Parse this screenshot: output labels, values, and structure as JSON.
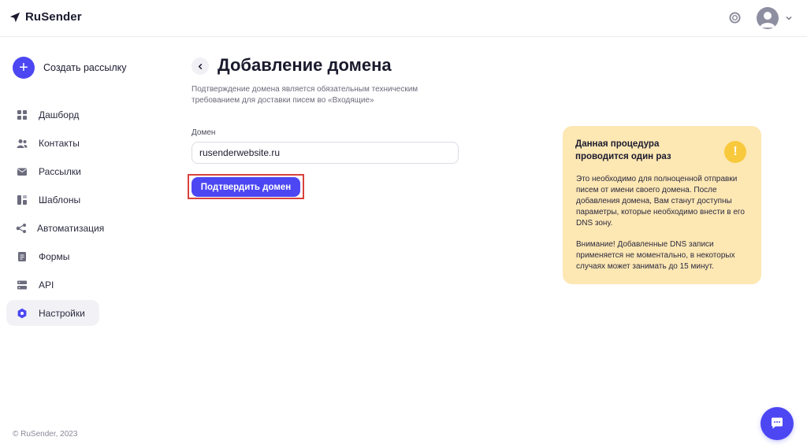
{
  "app": {
    "name": "RuSender"
  },
  "colors": {
    "accent": "#4c47f2",
    "info_bg": "#fde7b3",
    "warning": "#f8c93c",
    "highlight": "#d9413c"
  },
  "header": {
    "help_icon": "lifebuoy-icon",
    "avatar_icon": "user-avatar-icon",
    "menu_icon": "chevron-down-icon"
  },
  "sidebar": {
    "create_label": "Создать рассылку",
    "items": [
      {
        "label": "Дашборд",
        "icon": "dashboard-icon",
        "active": false
      },
      {
        "label": "Контакты",
        "icon": "contacts-icon",
        "active": false
      },
      {
        "label": "Рассылки",
        "icon": "mailings-icon",
        "active": false
      },
      {
        "label": "Шаблоны",
        "icon": "templates-icon",
        "active": false
      },
      {
        "label": "Автоматизация",
        "icon": "automation-icon",
        "active": false
      },
      {
        "label": "Формы",
        "icon": "forms-icon",
        "active": false
      },
      {
        "label": "API",
        "icon": "api-icon",
        "active": false
      },
      {
        "label": "Настройки",
        "icon": "settings-icon",
        "active": true
      }
    ],
    "footer": "© RuSender, 2023"
  },
  "main": {
    "title": "Добавление домена",
    "subtitle": "Подтверждение домена является обязательным техническим требованием для доставки писем во «Входящие»",
    "domain_label": "Домен",
    "domain_value": "rusenderwebsite.ru",
    "confirm_label": "Подтвердить домен"
  },
  "info": {
    "title": "Данная процедура проводится один раз",
    "text1": "Это необходимо для полноценной отправки писем от имени своего домена. После добавления домена, Вам станут доступны параметры, которые необходимо внести в его DNS зону.",
    "text2": "Внимание! Добавленные DNS записи применяется не моментально, в некоторых случаях может занимать до 15 минут.",
    "icon_glyph": "!"
  }
}
